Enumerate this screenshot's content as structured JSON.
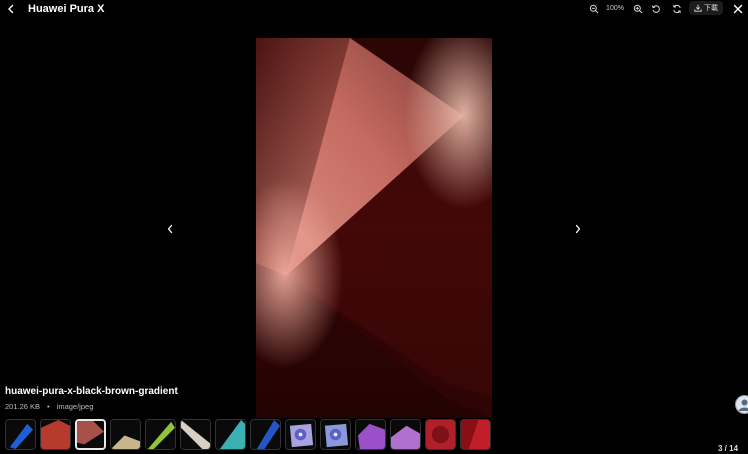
{
  "header": {
    "title": "Huawei Pura X",
    "zoom_level": "100%",
    "download_label": "下載"
  },
  "viewer": {
    "image_alt": "huawei-pura-x-black-brown-gradient"
  },
  "file": {
    "name": "huawei-pura-x-black-brown-gradient",
    "size": "201.26 KB",
    "separator": "•",
    "type": "image/jpeg"
  },
  "thumbnails": {
    "active_index": 2,
    "items": [
      {
        "icon": "blue-ribbon",
        "color": "#1e5fd6"
      },
      {
        "icon": "red-ribbon",
        "color": "#b83a2c"
      },
      {
        "icon": "brown-gradient",
        "color": "#a8504a"
      },
      {
        "icon": "gold-streaks",
        "color": "#c9b58a"
      },
      {
        "icon": "green-ribbon",
        "color": "#8ec63a"
      },
      {
        "icon": "silver-beam",
        "color": "#d8d0c4"
      },
      {
        "icon": "teal-ribbon",
        "color": "#3ab0b0"
      },
      {
        "icon": "navy-ribbon",
        "color": "#2456c8"
      },
      {
        "icon": "lavender-flower",
        "color": "#a8a4e0"
      },
      {
        "icon": "blue-flower",
        "color": "#8a9ad8"
      },
      {
        "icon": "purple-shapes",
        "color": "#9a50c8"
      },
      {
        "icon": "violet-shapes",
        "color": "#b070d0"
      },
      {
        "icon": "crimson-petals",
        "color": "#b0202a"
      },
      {
        "icon": "red-fold",
        "color": "#c01e28"
      }
    ]
  },
  "pagination": {
    "counter": "3 / 14"
  }
}
